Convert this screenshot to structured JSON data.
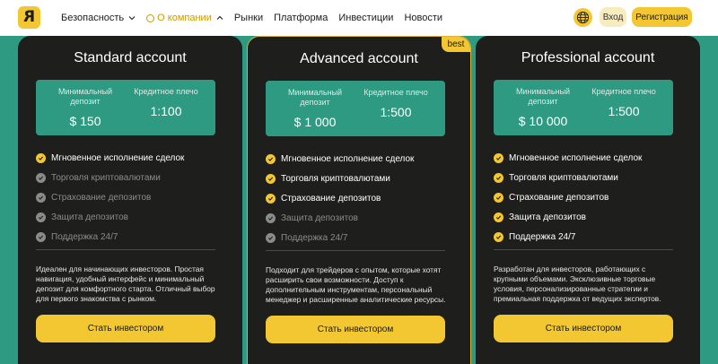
{
  "header": {
    "logo_icon": "logo-mark-icon",
    "nav": [
      {
        "label": "Безопасность",
        "dropdown": true
      },
      {
        "label": "О компании",
        "dropdown": true,
        "active": true
      },
      {
        "label": "Рынки"
      },
      {
        "label": "Платформа"
      },
      {
        "label": "Инвестиции"
      },
      {
        "label": "Новости"
      }
    ],
    "globe_icon": "globe-icon",
    "login_label": "Вход",
    "register_label": "Регистрация"
  },
  "colors": {
    "accent": "#f2c731",
    "teal": "#2f9a82",
    "card": "#1e1f1d"
  },
  "cards": [
    {
      "title": "Standard account",
      "stats": [
        {
          "label": "Минимальный депозит",
          "value": "$ 150"
        },
        {
          "label": "Кредитное плечо",
          "value": "1:100"
        }
      ],
      "features": [
        {
          "label": "Мгновенное исполнение сделок",
          "enabled": true
        },
        {
          "label": "Торговля криптовалютами",
          "enabled": false
        },
        {
          "label": "Страхование депозитов",
          "enabled": false
        },
        {
          "label": "Защита депозитов",
          "enabled": false
        },
        {
          "label": "Поддержка 24/7",
          "enabled": false
        }
      ],
      "description": "Идеален для начинающих инвесторов. Простая навигация, удобный интерфейс и минимальный депозит для комфортного старта. Отличный выбор для первого знакомства с рынком.",
      "cta": "Стать инвестором"
    },
    {
      "title": "Advanced account",
      "badge": "best",
      "stats": [
        {
          "label": "Минимальный депозит",
          "value": "$ 1 000"
        },
        {
          "label": "Кредитное плечо",
          "value": "1:500"
        }
      ],
      "features": [
        {
          "label": "Мгновенное исполнение сделок",
          "enabled": true
        },
        {
          "label": "Торговля криптовалютами",
          "enabled": true
        },
        {
          "label": "Страхование депозитов",
          "enabled": true
        },
        {
          "label": "Защита депозитов",
          "enabled": false
        },
        {
          "label": "Поддержка 24/7",
          "enabled": false
        }
      ],
      "description": "Подходит для трейдеров с опытом, которые хотят расширить свои возможности. Доступ к дополнительным инструментам, персональный менеджер и расширенные аналитические ресурсы.",
      "cta": "Стать инвестором"
    },
    {
      "title": "Professional account",
      "stats": [
        {
          "label": "Минимальный депозит",
          "value": "$ 10 000"
        },
        {
          "label": "Кредитное плечо",
          "value": "1:500"
        }
      ],
      "features": [
        {
          "label": "Мгновенное исполнение сделок",
          "enabled": true
        },
        {
          "label": "Торговля криптовалютами",
          "enabled": true
        },
        {
          "label": "Страхование депозитов",
          "enabled": true
        },
        {
          "label": "Защита депозитов",
          "enabled": true
        },
        {
          "label": "Поддержка 24/7",
          "enabled": true
        }
      ],
      "description": "Разработан для инвесторов, работающих с крупными объемами. Эксклюзивные торговые условия, персонализированные стратегии и премиальная поддержка от ведущих экспертов.",
      "cta": "Стать инвестором"
    }
  ]
}
